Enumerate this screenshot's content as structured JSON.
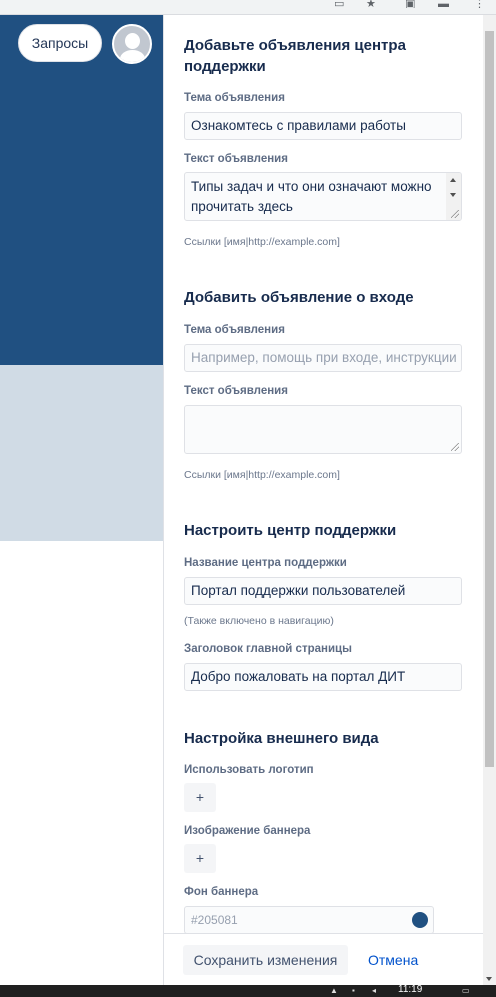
{
  "left": {
    "requests_button": "Запросы"
  },
  "announcement_section": {
    "title_line1": "Добавьте объявления центра",
    "title_line2": "поддержки",
    "subject_label": "Тема объявления",
    "subject_value": "Ознакомтесь с правилами работы",
    "text_label": "Текст объявления",
    "text_value": "Типы задач и что они означают можно прочитать здесь",
    "links_hint": "Ссылки [имя|http://example.com]"
  },
  "login_section": {
    "title": "Добавить объявление о входе",
    "subject_label": "Тема объявления",
    "subject_placeholder": "Например, помощь при входе, инструкции",
    "text_label": "Текст объявления",
    "text_value": "",
    "links_hint": "Ссылки [имя|http://example.com]"
  },
  "setup_section": {
    "title": "Настроить центр поддержки",
    "name_label": "Название центра поддержки",
    "name_value": "Портал поддержки пользователей",
    "name_hint": "(Также включено в навигацию)",
    "heading_label": "Заголовок главной страницы",
    "heading_value": "Добро пожаловать на портал ДИТ"
  },
  "appearance_section": {
    "title": "Настройка внешнего вида",
    "logo_label": "Использовать логотип",
    "logo_add": "+",
    "banner_label": "Изображение баннера",
    "banner_add": "+",
    "bg_label": "Фон баннера",
    "bg_value": "#205081"
  },
  "footer": {
    "save_label": "Сохранить изменения",
    "cancel_label": "Отмена"
  },
  "taskbar": {
    "clock": "11:19"
  },
  "colors": {
    "banner_blue": "#205081",
    "banner_grey": "#d0dbe5",
    "link": "#0052cc"
  }
}
